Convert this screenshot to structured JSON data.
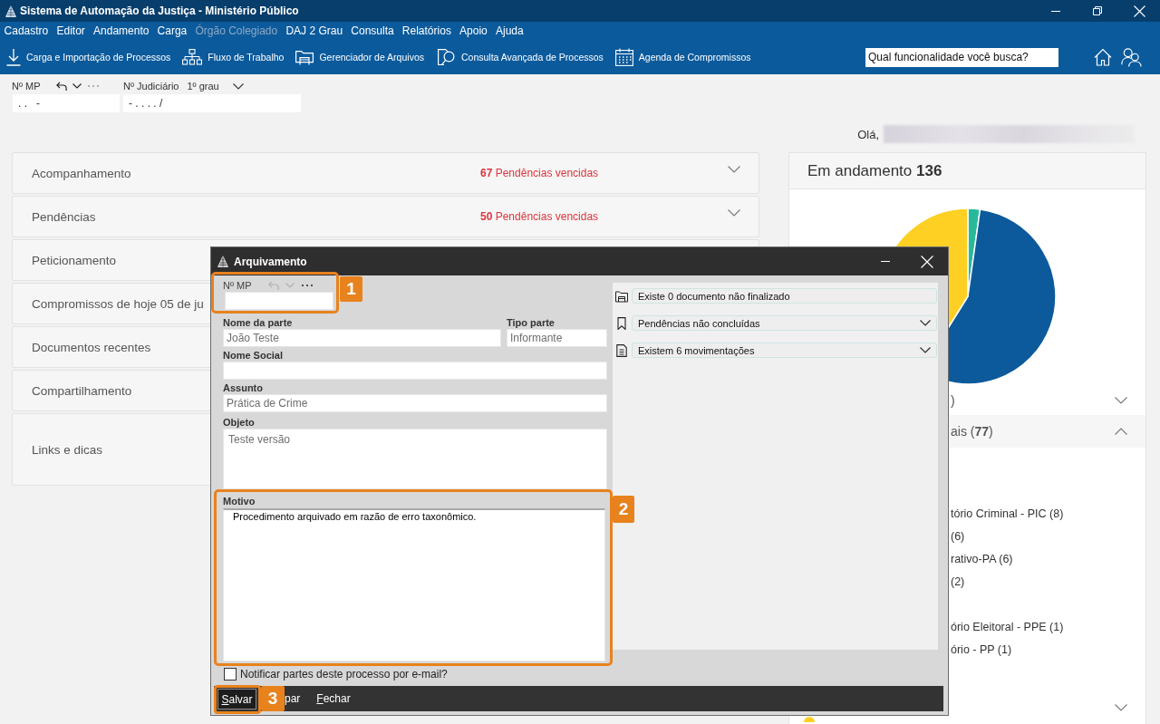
{
  "window": {
    "title": "Sistema de Automação da Justiça - Ministério Público"
  },
  "menu": [
    {
      "label": "Cadastro",
      "disabled": false
    },
    {
      "label": "Editor",
      "disabled": false
    },
    {
      "label": "Andamento",
      "disabled": false
    },
    {
      "label": "Carga",
      "disabled": false
    },
    {
      "label": "Órgão Colegiado",
      "disabled": true
    },
    {
      "label": "DAJ 2 Grau",
      "disabled": false
    },
    {
      "label": "Consulta",
      "disabled": false
    },
    {
      "label": "Relatórios",
      "disabled": false
    },
    {
      "label": "Apoio",
      "disabled": false
    },
    {
      "label": "Ajuda",
      "disabled": false
    }
  ],
  "toolbar": [
    {
      "label": "Carga e Importação de Processos"
    },
    {
      "label": "Fluxo de Trabalho"
    },
    {
      "label": "Gerenciador de Arquivos"
    },
    {
      "label": "Consulta Avançada de Processos"
    },
    {
      "label": "Agenda de Compromissos"
    }
  ],
  "search": {
    "placeholder": "Qual funcionalidade você busca?"
  },
  "record_bar": {
    "mp": {
      "label": "Nº MP",
      "value": ". .   -",
      "undo_disabled": false,
      "more_disabled": true
    },
    "judicial": {
      "label": "Nº Judiciário",
      "instance": "1º grau",
      "value": "- . . . . /"
    }
  },
  "greeting": "Olá,",
  "sections": [
    {
      "title": "Acompanhamento",
      "alert": "**67** Pendências vencidas",
      "expanded": false
    },
    {
      "title": "Pendências",
      "alert": "**50** Pendências vencidas",
      "expanded": false
    },
    {
      "title": "Peticionamento"
    },
    {
      "title": "Compromissos de hoje 05 de ju"
    },
    {
      "title": "Documentos recentes"
    },
    {
      "title": "Compartilhamento"
    },
    {
      "title": "Links e dicas"
    }
  ],
  "summary": {
    "title": "Em andamento **136**",
    "groups": [
      {
        "label": ")",
        "expanded": false
      },
      {
        "label": "ais (**77**)",
        "expanded": true,
        "children": [
          {
            "label": "tório Criminal - PIC (8)"
          },
          {
            "label": "(6)"
          },
          {
            "label": "rativo-PA (6)"
          },
          {
            "label": "(2)"
          },
          {
            "label": "ório Eleitoral - PPE (1)"
          },
          {
            "label": "ório - PP (1)"
          }
        ]
      },
      {
        "color": "#fdd023",
        "expanded": false
      }
    ]
  },
  "dialog": {
    "title": "Arquivamento",
    "mp": {
      "label": "Nº MP",
      "undo_disabled": true,
      "more_disabled": false
    },
    "party": {
      "name_label": "Nome da parte",
      "name_value": "João Teste",
      "type_label": "Tipo parte",
      "type_value": "Informante"
    },
    "social_name": {
      "label": "Nome Social"
    },
    "subject": {
      "label": "Assunto",
      "value": "Prática de Crime"
    },
    "object": {
      "label": "Objeto",
      "value": "Teste versão"
    },
    "reason": {
      "label": "Motivo",
      "value": "Procedimento arquivado em razão de erro taxonômico."
    },
    "notify": {
      "label": "Notificar partes deste processo por e-mail?",
      "checked": false
    },
    "info": [
      {
        "label": "Existe 0 documento não finalizado",
        "kind": "notice"
      },
      {
        "label": "Pendências não concluídas",
        "kind": "collapsible"
      },
      {
        "label": "Existem 6 movimentações",
        "kind": "collapsible"
      }
    ],
    "buttons": [
      {
        "label": "Salvar",
        "focused": true,
        "underline_first": true
      },
      {
        "label": "par",
        "focused": false,
        "underline_first": false
      },
      {
        "label": "Fechar",
        "focused": false,
        "underline_first": true
      }
    ],
    "callouts": [
      {
        "number": "1"
      },
      {
        "number": "2"
      },
      {
        "number": "3"
      }
    ]
  }
}
